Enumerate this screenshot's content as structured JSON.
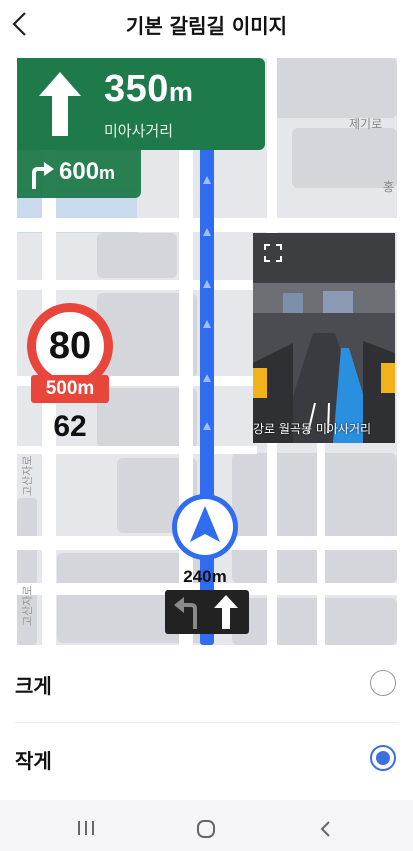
{
  "header": {
    "title": "기본 갈림길 이미지",
    "back_icon": "chevron-left-icon"
  },
  "map": {
    "street_labels": [
      "제기로",
      "홍",
      "고산자로",
      "고산자로"
    ]
  },
  "guidance": {
    "distance_value": "350",
    "distance_unit": "m",
    "road_name": "미아사거리",
    "turn_icon": "arrow-up-icon",
    "next_distance_value": "600",
    "next_distance_unit": "m",
    "next_turn_icon": "turn-right-icon"
  },
  "speed": {
    "limit": "80",
    "camera_distance": "500m",
    "current": "62"
  },
  "junction_view": {
    "expand_icon": "expand-icon",
    "labels": "강로  월곡동  미아사거리"
  },
  "lane": {
    "distance": "240m",
    "lanes": [
      "turn-left",
      "straight"
    ]
  },
  "options": [
    {
      "label": "크게",
      "selected": false
    },
    {
      "label": "작게",
      "selected": true
    }
  ],
  "navbar": {
    "recents_icon": "recents-icon",
    "home_icon": "home-icon",
    "back_icon": "back-icon"
  },
  "colors": {
    "guide_green": "#1e7a4a",
    "route_blue": "#2f6cf0",
    "speed_red": "#e8463b",
    "radio_blue": "#3b6fe0"
  }
}
